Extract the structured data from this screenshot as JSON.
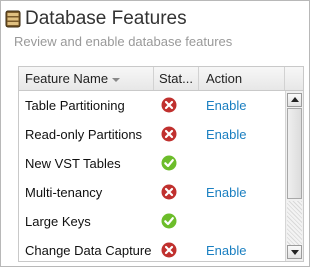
{
  "panel": {
    "title": "Database Features",
    "subtitle": "Review and enable database features",
    "icon": "database-icon"
  },
  "grid": {
    "columns": {
      "name": "Feature Name",
      "status": "Stat...",
      "action": "Action"
    },
    "sort": {
      "column": "name",
      "direction": "descending"
    },
    "rows": [
      {
        "name": "Table Partitioning",
        "status": "error-x-icon",
        "action": "Enable"
      },
      {
        "name": "Read-only Partitions",
        "status": "error-x-icon",
        "action": "Enable"
      },
      {
        "name": "New VST Tables",
        "status": "check-icon",
        "action": ""
      },
      {
        "name": "Multi-tenancy",
        "status": "error-x-icon",
        "action": "Enable"
      },
      {
        "name": "Large Keys",
        "status": "check-icon",
        "action": ""
      },
      {
        "name": "Change Data Capture",
        "status": "error-x-icon",
        "action": "Enable"
      }
    ]
  },
  "colors": {
    "link": "#1a7fc1",
    "error": "#c0302e",
    "success": "#6cbd2a"
  }
}
